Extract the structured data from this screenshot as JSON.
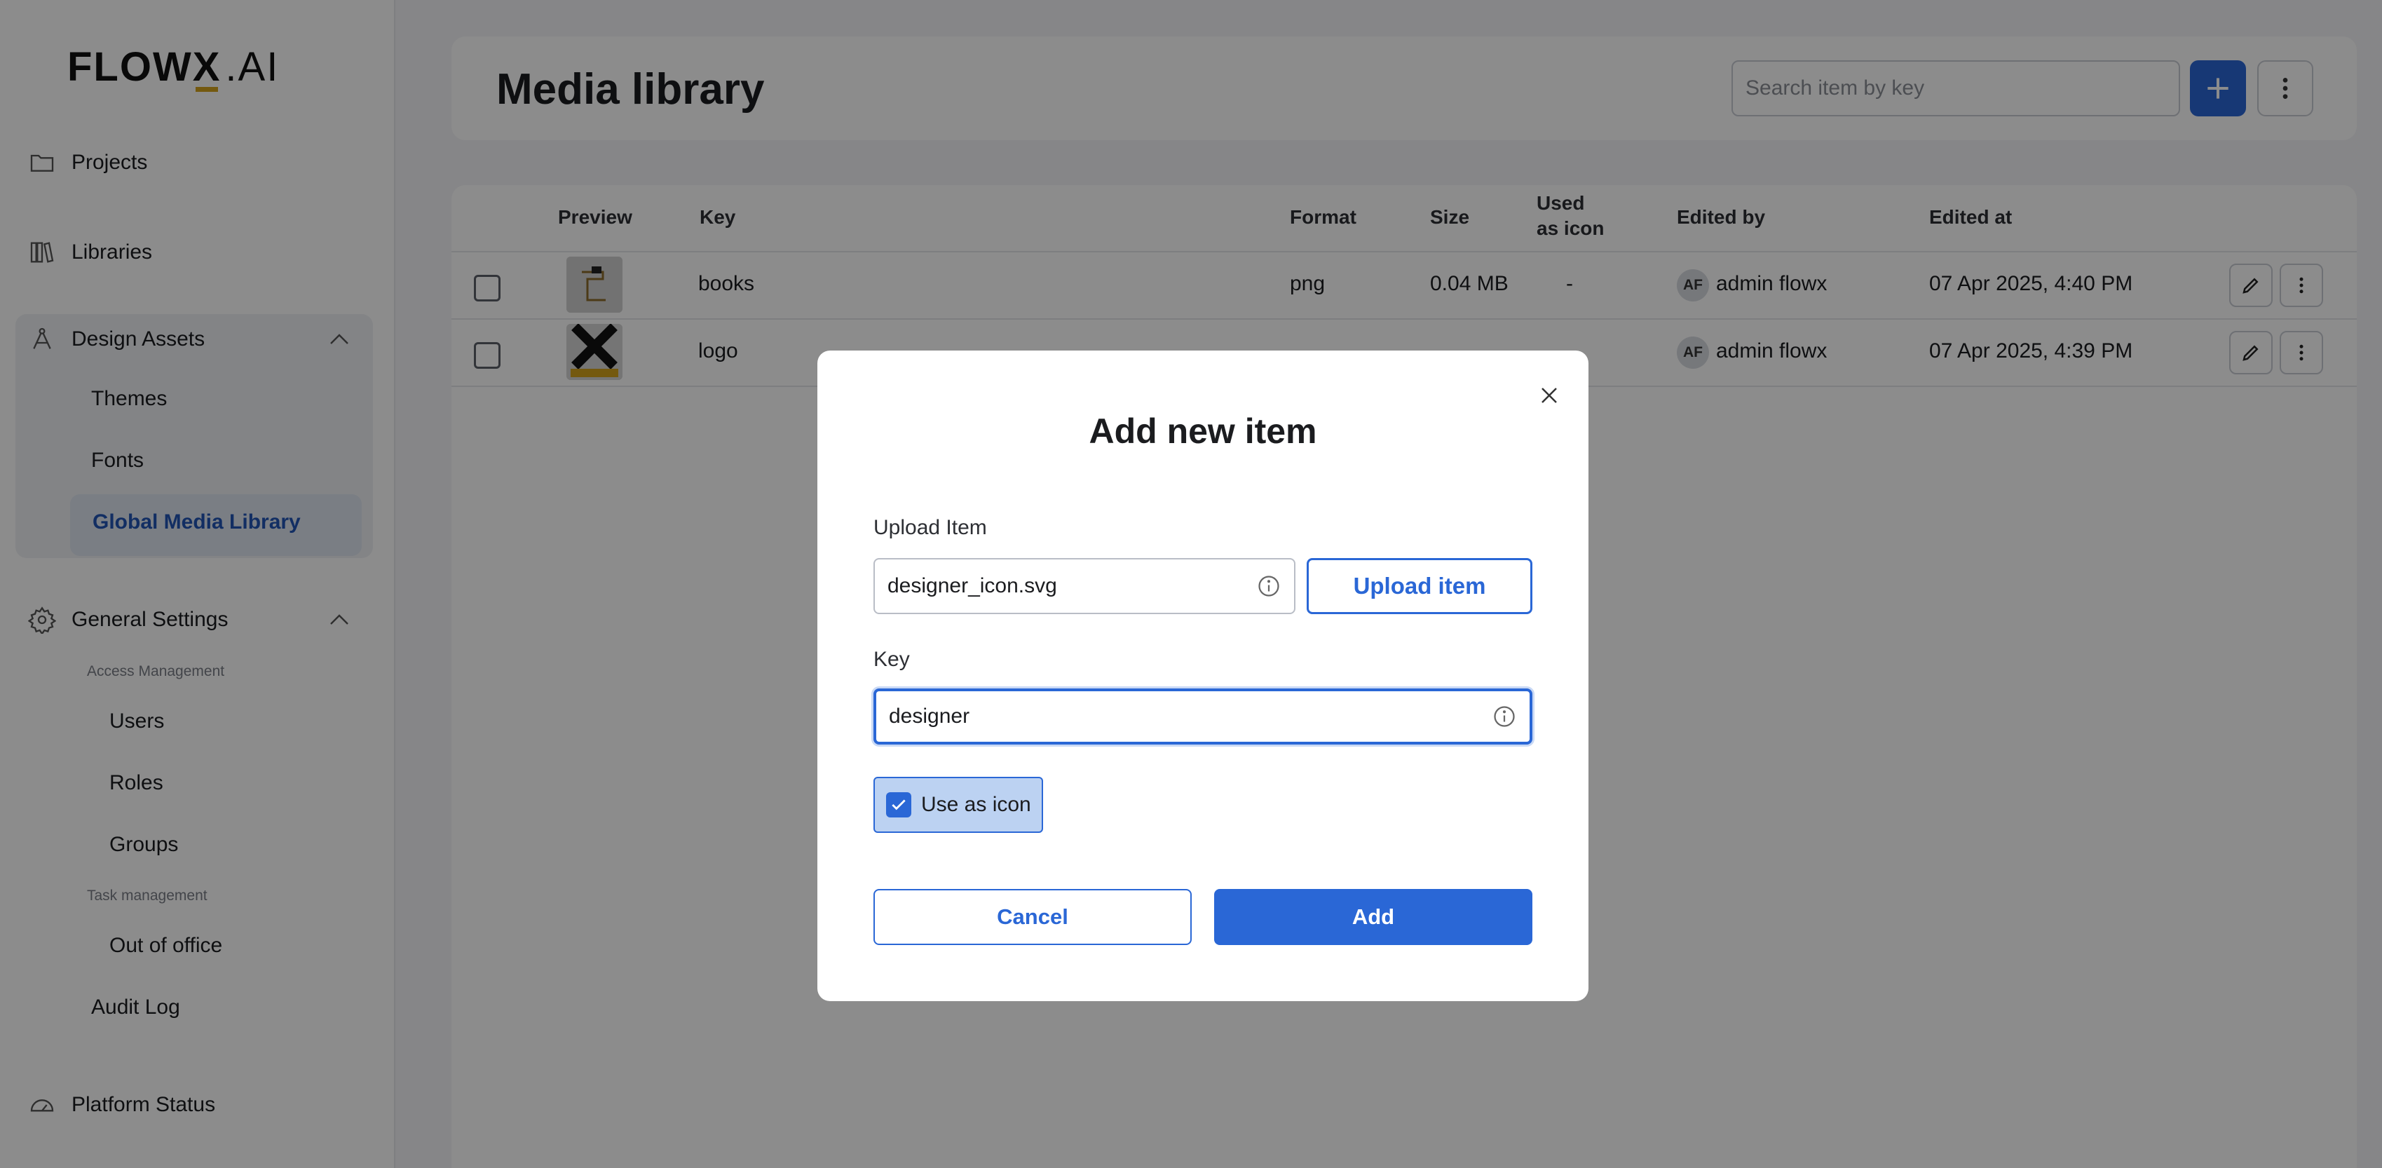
{
  "brand": {
    "logo_text": "FLOW",
    "logo_x": "X",
    "logo_ai": ".AI",
    "accent": "#2a67d6",
    "logo_underline": "#d4a21c"
  },
  "sidebar": {
    "projects": "Projects",
    "libraries": "Libraries",
    "design_assets": "Design Assets",
    "design_assets_items": [
      "Themes",
      "Fonts",
      "Global Media Library"
    ],
    "general_settings": "General Settings",
    "access_management": "Access Management",
    "access_items": [
      "Users",
      "Roles",
      "Groups"
    ],
    "task_management": "Task management",
    "task_items": [
      "Out of office"
    ],
    "audit_log": "Audit Log",
    "platform_status": "Platform Status"
  },
  "header": {
    "title": "Media library",
    "search_placeholder": "Search item by key"
  },
  "table": {
    "columns": {
      "preview": "Preview",
      "key": "Key",
      "format": "Format",
      "size": "Size",
      "used_as_icon_1": "Used",
      "used_as_icon_2": "as icon",
      "edited_by": "Edited by",
      "edited_at": "Edited at"
    },
    "rows": [
      {
        "key": "books",
        "format": "png",
        "size": "0.04 MB",
        "used_as_icon": "-",
        "avatar": "AF",
        "edited_by": "admin flowx",
        "edited_at": "07 Apr 2025, 4:40 PM"
      },
      {
        "key": "logo",
        "format": "",
        "size": "",
        "used_as_icon": "",
        "avatar": "AF",
        "edited_by": "admin flowx",
        "edited_at": "07 Apr 2025, 4:39 PM"
      }
    ]
  },
  "modal": {
    "title": "Add new item",
    "upload_label": "Upload Item",
    "upload_value": "designer_icon.svg",
    "upload_button": "Upload item",
    "key_label": "Key",
    "key_value": "designer",
    "use_as_icon": "Use as icon",
    "use_as_icon_checked": true,
    "cancel": "Cancel",
    "add": "Add"
  }
}
